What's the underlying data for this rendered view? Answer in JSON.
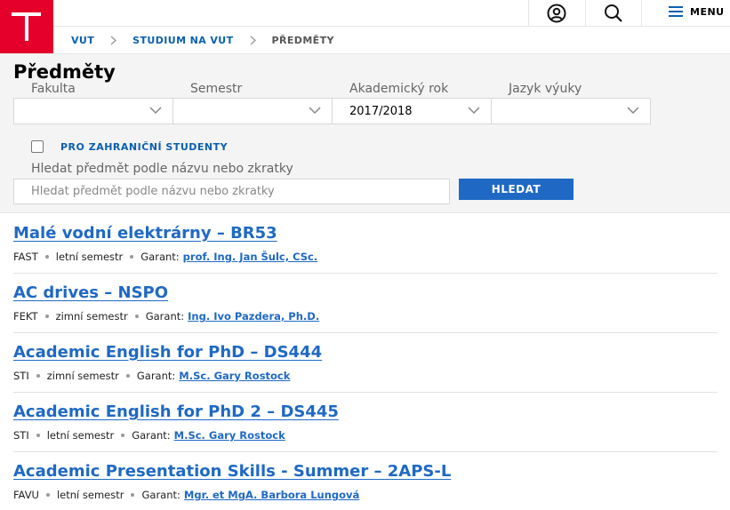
{
  "header": {
    "menu_label": "MENU"
  },
  "breadcrumb": [
    "VUT",
    "STUDIUM NA VUT",
    "PŘEDMĚTY"
  ],
  "page_title": "Předměty",
  "filters": {
    "selects": [
      {
        "label": "Fakulta",
        "value": ""
      },
      {
        "label": "Semestr",
        "value": ""
      },
      {
        "label": "Akademický rok",
        "value": "2017/2018"
      },
      {
        "label": "Jazyk výuky",
        "value": ""
      }
    ],
    "foreign_students_label": "PRO ZAHRANIČNÍ STUDENTY",
    "search_label": "Hledat předmět podle názvu nebo zkratky",
    "search_placeholder": "Hledat předmět podle názvu nebo zkratky",
    "search_button": "HLEDAT"
  },
  "garant_label": "Garant:",
  "courses": [
    {
      "title": "Malé vodní elektrárny – BR53",
      "faculty": "FAST",
      "semester": "letní semestr",
      "garant": "prof. Ing. Jan Šulc, CSc."
    },
    {
      "title": "AC drives – NSPO",
      "faculty": "FEKT",
      "semester": "zimní semestr",
      "garant": "Ing. Ivo Pazdera, Ph.D."
    },
    {
      "title": "Academic English for PhD – DS444",
      "faculty": "STI",
      "semester": "zimní semestr",
      "garant": "M.Sc. Gary Rostock"
    },
    {
      "title": "Academic English for PhD 2 – DS445",
      "faculty": "STI",
      "semester": "letní semestr",
      "garant": "M.Sc. Gary Rostock"
    },
    {
      "title": "Academic Presentation Skills - Summer – 2APS-L",
      "faculty": "FAVU",
      "semester": "letní semestr",
      "garant": "Mgr. et MgA. Barbora Lungová"
    }
  ]
}
